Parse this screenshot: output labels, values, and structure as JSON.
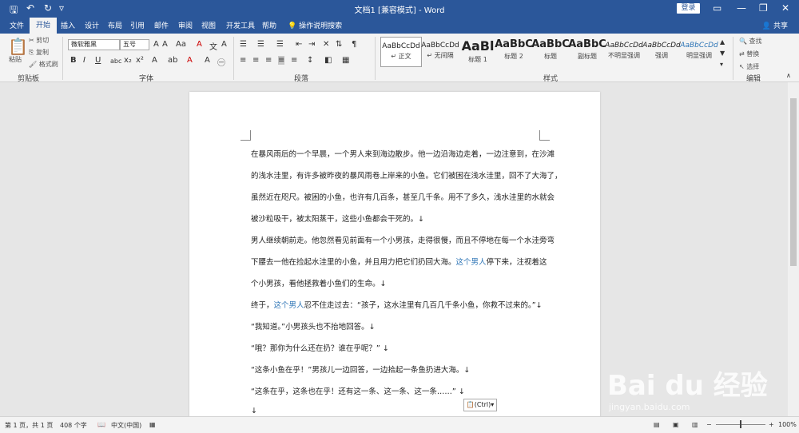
{
  "window": {
    "title": "文档1 [兼容模式] - Word",
    "login_label": "登录",
    "share_label": "共享"
  },
  "menu": {
    "tabs": [
      "文件",
      "开始",
      "插入",
      "设计",
      "布局",
      "引用",
      "邮件",
      "审阅",
      "视图",
      "开发工具",
      "帮助"
    ],
    "active_tab": "开始",
    "tellme": "操作说明搜索"
  },
  "ribbon": {
    "clipboard": {
      "paste": "粘贴",
      "cut": "剪切",
      "copy": "复制",
      "format_painter": "格式刷",
      "label": "剪贴板"
    },
    "font": {
      "name": "微软雅黑",
      "size": "五号",
      "label": "字体"
    },
    "paragraph": {
      "label": "段落"
    },
    "styles": {
      "label": "样式",
      "items": [
        {
          "sample": "AaBbCcDd",
          "name": "↵ 正文"
        },
        {
          "sample": "AaBbCcDd",
          "name": "↵ 无间隔"
        },
        {
          "sample": "AaBl",
          "name": "标题 1"
        },
        {
          "sample": "AaBbC",
          "name": "标题 2"
        },
        {
          "sample": "AaBbC",
          "name": "标题"
        },
        {
          "sample": "AaBbC",
          "name": "副标题"
        },
        {
          "sample": "AaBbCcDd",
          "name": "不明显强调"
        },
        {
          "sample": "AaBbCcDd",
          "name": "强调"
        },
        {
          "sample": "AaBbCcDd",
          "name": "明显强调"
        }
      ]
    },
    "editing": {
      "find": "查找",
      "replace": "替换",
      "select": "选择",
      "label": "编辑"
    }
  },
  "document": {
    "lines": [
      "在暴风雨后的一个早晨，一个男人来到海边散步。他一边沿海边走着，一边注意到，在沙滩",
      "的浅水洼里，有许多被昨夜的暴风雨卷上岸来的小鱼。它们被困在浅水洼里，回不了大海了，",
      "虽然近在咫尺。被困的小鱼，也许有几百条，甚至几千条。用不了多久，浅水洼里的水就会",
      "被沙粒吸干，被太阳蒸干，这些小鱼都会干死的。↓",
      "男人继续朝前走。他忽然看见前面有一个小男孩，走得很慢，而且不停地在每一个水洼旁弯",
      "下腰去一他在捡起水洼里的小鱼，并且用力把它们扔回大海。",
      "这个男人",
      "停下来，注视着这",
      "个小男孩，看他拯救着小鱼们的生命。↓",
      "终于，",
      "这个男人",
      "忍不住走过去：“孩子，这水洼里有几百几千条小鱼，你救不过来的。”↓",
      "“我知道。”小男孩头也不抬地回答。↓",
      "“哦？那你为什么还在扔？谁在乎呢？” ↓",
      "“这条小鱼在乎！”男孩儿一边回答，一边拾起一条鱼扔进大海。↓",
      "“这条在乎，这条也在乎！还有这一条、这一条、这一条……” ↓",
      "↓"
    ],
    "paste_ctrl": "(Ctrl)"
  },
  "status": {
    "page": "第 1 页，共 1 页",
    "words": "408 个字",
    "lang": "中文(中国)",
    "zoom": "100%"
  },
  "watermark": {
    "brand": "Bai du 经验",
    "url": "jingyan.baidu.com"
  }
}
